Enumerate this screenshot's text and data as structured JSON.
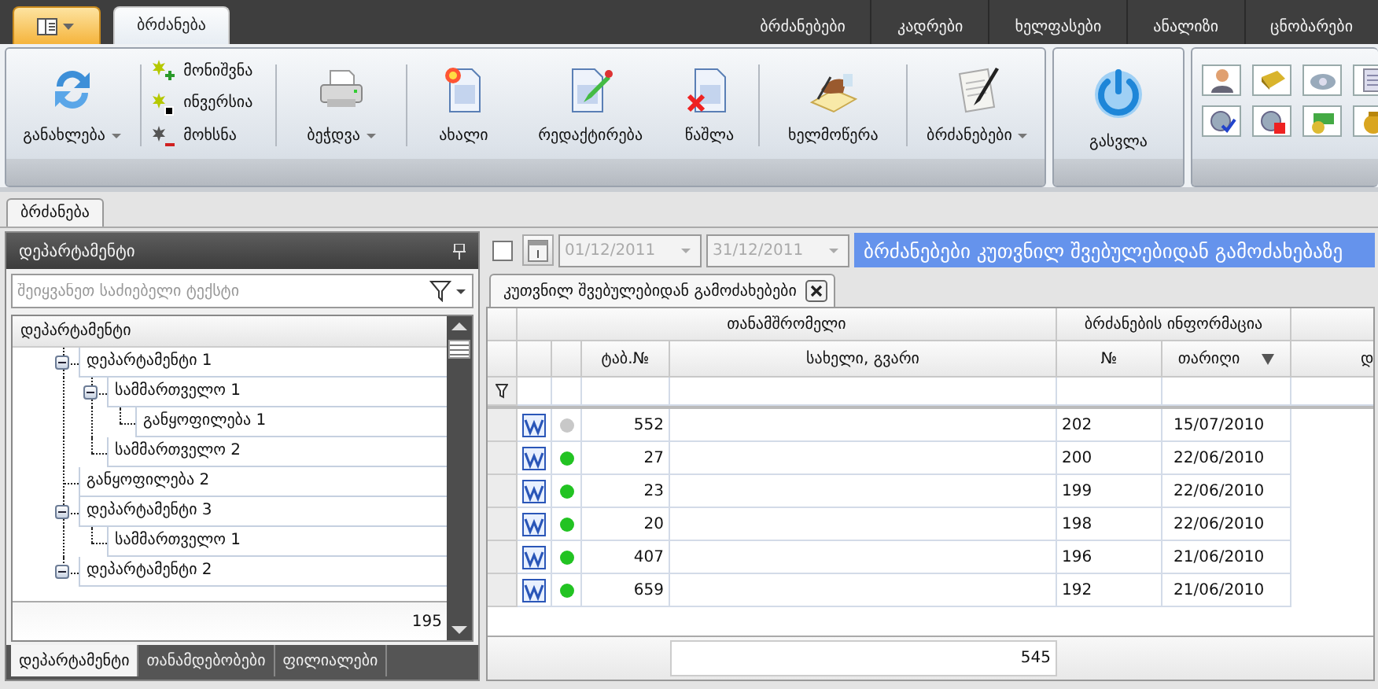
{
  "ribbon_tabs": [
    {
      "label": "ბრძანება",
      "selected": true
    }
  ],
  "module_tabs": [
    "ბრძანებები",
    "კადრები",
    "ხელფასები",
    "ანალიზი",
    "ცნობარები"
  ],
  "ribbon": {
    "refresh": {
      "label": "განახლება",
      "dropdown": true
    },
    "selection": [
      "მონიშვნა",
      "ინვერსია",
      "მოხსნა"
    ],
    "print": {
      "label": "ბეჭდვა",
      "dropdown": true
    },
    "actions": [
      {
        "label": "ახალი",
        "dropdown": false
      },
      {
        "label": "რედაქტირება",
        "dropdown": false
      },
      {
        "label": "წაშლა",
        "dropdown": false
      },
      {
        "label": "ხელმოწერა",
        "dropdown": false
      },
      {
        "label": "ბრძანებები",
        "dropdown": true
      }
    ],
    "exit": {
      "label": "გასვლა"
    }
  },
  "document_tabs": [
    {
      "label": "ბრძანება",
      "selected": true
    }
  ],
  "department_panel": {
    "title": "დეპარტამენტი",
    "search": {
      "placeholder": "შეიყვანეთ საძიებელი ტექსტი"
    },
    "tree_header": "დეპარტამენტი",
    "tree": [
      {
        "label": "დეპარტამენტი 1",
        "expanded": true,
        "children": [
          {
            "label": "სამმართველო 1",
            "expanded": true,
            "children": [
              {
                "label": "განყოფილება 1"
              }
            ]
          },
          {
            "label": "სამმართველო 2"
          }
        ]
      },
      {
        "label": "განყოფილება 2"
      },
      {
        "label": "დეპარტამენტი 3",
        "expanded": true,
        "children": [
          {
            "label": "სამმართველო 1"
          }
        ]
      },
      {
        "label": "დეპარტამენტი 2",
        "expanded": true
      }
    ],
    "footer": "195",
    "tabs": [
      {
        "label": "დეპარტამენტი",
        "selected": true
      },
      {
        "label": "თანამდებობები",
        "selected": false
      },
      {
        "label": "ფილიალები",
        "selected": false
      }
    ]
  },
  "filter_bar": {
    "checked": false,
    "date_from": {
      "value": "01/12/2011",
      "disabled": true
    },
    "date_to": {
      "value": "31/12/2011",
      "disabled": true
    },
    "banner": "ბრძანებები კუთვნილ შვებულებიდან გამოძახებაზე"
  },
  "result_tabs": [
    {
      "label": "კუთვნილ შვებულებიდან გამოძახებები",
      "selected": true
    }
  ],
  "grid": {
    "bands": [
      "თანამშრომელი",
      "ბრძანების ინფორმაცია"
    ],
    "columns": [
      {
        "label": "ტაბ.№"
      },
      {
        "label": "სახელი, გვარი"
      },
      {
        "label": "№"
      },
      {
        "label": "თარიღი",
        "sorted_descending": true
      },
      {
        "label": "დ"
      }
    ],
    "rows": [
      {
        "tab_no": "552",
        "order_no": "202",
        "date": "15/07/2010",
        "color": "#c8c8c8"
      },
      {
        "tab_no": "27",
        "order_no": "200",
        "date": "22/06/2010",
        "color": "#22c322"
      },
      {
        "tab_no": "23",
        "order_no": "199",
        "date": "22/06/2010",
        "color": "#22c322"
      },
      {
        "tab_no": "20",
        "order_no": "198",
        "date": "22/06/2010",
        "color": "#22c322"
      },
      {
        "tab_no": "407",
        "order_no": "196",
        "date": "21/06/2010",
        "color": "#22c322"
      },
      {
        "tab_no": "659",
        "order_no": "192",
        "date": "21/06/2010",
        "color": "#22c322"
      }
    ],
    "footer": "545"
  }
}
